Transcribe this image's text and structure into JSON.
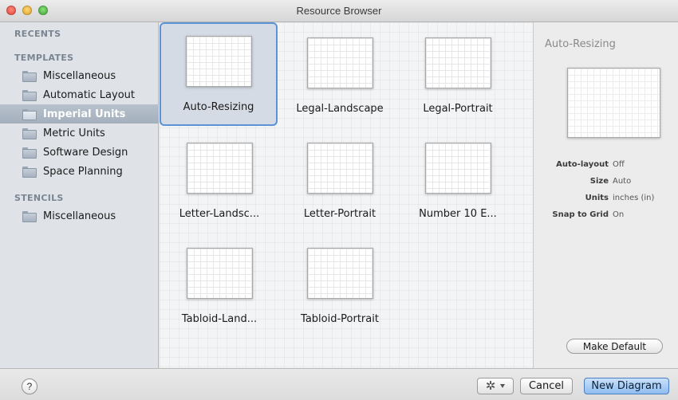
{
  "window": {
    "title": "Resource Browser"
  },
  "sidebar": {
    "recents_header": "RECENTS",
    "templates_header": "TEMPLATES",
    "templates": [
      {
        "label": "Miscellaneous"
      },
      {
        "label": "Automatic Layout"
      },
      {
        "label": "Imperial Units"
      },
      {
        "label": "Metric Units"
      },
      {
        "label": "Software Design"
      },
      {
        "label": "Space Planning"
      }
    ],
    "selected": "Imperial Units",
    "stencils_header": "STENCILS",
    "stencils": [
      {
        "label": "Miscellaneous"
      }
    ]
  },
  "templates_grid": [
    {
      "label": "Auto-Resizing"
    },
    {
      "label": "Legal-Landscape"
    },
    {
      "label": "Legal-Portrait"
    },
    {
      "label": "Letter-Landsc..."
    },
    {
      "label": "Letter-Portrait"
    },
    {
      "label": "Number 10 E..."
    },
    {
      "label": "Tabloid-Land..."
    },
    {
      "label": "Tabloid-Portrait"
    }
  ],
  "selected_template": "Auto-Resizing",
  "inspector": {
    "title": "Auto-Resizing",
    "props": [
      {
        "key": "Auto-layout",
        "value": "Off"
      },
      {
        "key": "Size",
        "value": "Auto"
      },
      {
        "key": "Units",
        "value": "inches (in)"
      },
      {
        "key": "Snap to Grid",
        "value": "On"
      }
    ],
    "make_default_label": "Make Default"
  },
  "footer": {
    "help_label": "?",
    "gear_icon": "gear-icon",
    "cancel_label": "Cancel",
    "new_diagram_label": "New Diagram"
  }
}
